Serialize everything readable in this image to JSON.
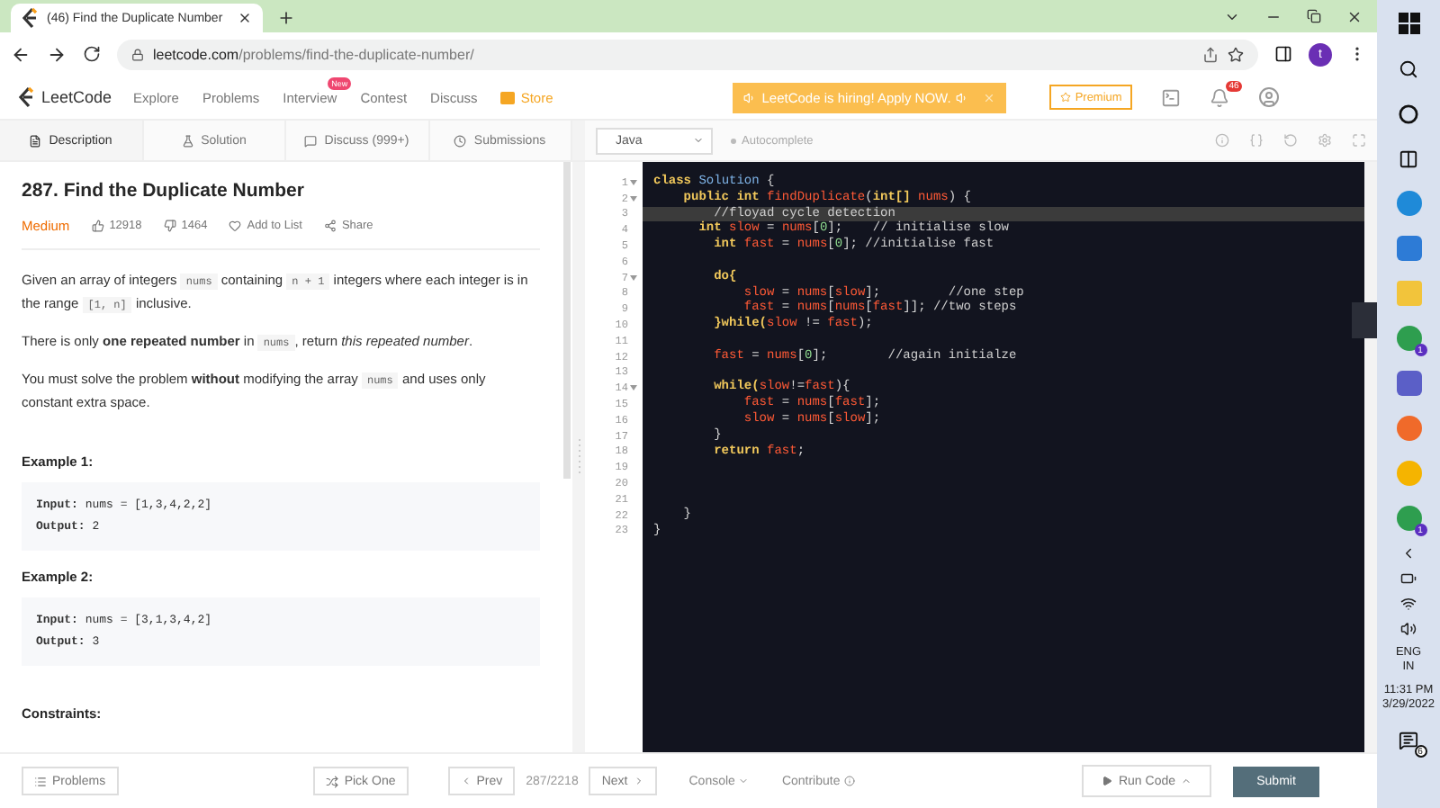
{
  "browser": {
    "tab_title": "(46) Find the Duplicate Number",
    "url_host": "leetcode.com",
    "url_path": "/problems/find-the-duplicate-number/",
    "avatar_letter": "t"
  },
  "nav": {
    "brand": "LeetCode",
    "links": [
      {
        "label": "Explore"
      },
      {
        "label": "Problems"
      },
      {
        "label": "Interview",
        "badge": "New"
      },
      {
        "label": "Contest"
      },
      {
        "label": "Discuss"
      }
    ],
    "store": "Store",
    "banner": "LeetCode is hiring! Apply NOW.",
    "premium": "Premium",
    "notification_count": "46"
  },
  "tabs": [
    {
      "label": "Description",
      "kind": "description",
      "selected": true
    },
    {
      "label": "Solution",
      "kind": "solution",
      "selected": false
    },
    {
      "label": "Discuss (999+)",
      "kind": "discuss",
      "selected": false
    },
    {
      "label": "Submissions",
      "kind": "submissions",
      "selected": false
    }
  ],
  "problem": {
    "title": "287. Find the Duplicate Number",
    "difficulty": "Medium",
    "likes": "12918",
    "dislikes": "1464",
    "add_to_list": "Add to List",
    "share": "Share",
    "paragraphs": [
      [
        {
          "kind": "text",
          "text": "Given an array of integers "
        },
        {
          "kind": "code",
          "text": "nums"
        },
        {
          "kind": "text",
          "text": " containing "
        },
        {
          "kind": "code",
          "text": "n + 1"
        },
        {
          "kind": "text",
          "text": " integers where each integer is in the range "
        },
        {
          "kind": "code",
          "text": "[1, n]"
        },
        {
          "kind": "text",
          "text": " inclusive."
        }
      ],
      [
        {
          "kind": "text",
          "text": "There is only **one repeated number** in "
        },
        {
          "kind": "code",
          "text": "nums"
        },
        {
          "kind": "text",
          "text": ", return *this repeated number*."
        }
      ],
      [
        {
          "kind": "text",
          "text": "You must solve the problem **without** modifying the array "
        },
        {
          "kind": "code",
          "text": "nums"
        },
        {
          "kind": "text",
          "text": " and uses only constant extra space."
        }
      ]
    ],
    "examples": [
      {
        "heading": "Example 1:",
        "input_label": "Input:",
        "input": "nums = [1,3,4,2,2]",
        "output_label": "Output:",
        "output": "2"
      },
      {
        "heading": "Example 2:",
        "input_label": "Input:",
        "input": "nums = [3,1,3,4,2]",
        "output_label": "Output:",
        "output": "3"
      }
    ],
    "constraints_heading": "Constraints:"
  },
  "editor": {
    "language": "Java",
    "autocomplete": "Autocomplete",
    "lines": [
      {
        "number": "1",
        "foldable": true,
        "active": false,
        "tokens": [
          {
            "kind": "kw",
            "text": "class"
          },
          {
            "kind": "type",
            "text": " Solution"
          },
          {
            "kind": "punct",
            "text": " {"
          }
        ]
      },
      {
        "number": "2",
        "foldable": true,
        "active": false,
        "tokens": [
          {
            "kind": "kw",
            "text": "    public int"
          },
          {
            "kind": "ident",
            "text": " findDuplicate"
          },
          {
            "kind": "punct",
            "text": "("
          },
          {
            "kind": "kw",
            "text": "int[]"
          },
          {
            "kind": "ident",
            "text": " nums"
          },
          {
            "kind": "punct",
            "text": ") {"
          }
        ]
      },
      {
        "number": "3",
        "foldable": false,
        "active": true,
        "tokens": [
          {
            "kind": "comment",
            "text": "        //floyad cycle detection"
          }
        ]
      },
      {
        "number": "4",
        "foldable": false,
        "active": false,
        "tokens": [
          {
            "kind": "kw",
            "text": "      int"
          },
          {
            "kind": "ident",
            "text": " slow"
          },
          {
            "kind": "punct",
            "text": " = "
          },
          {
            "kind": "ident",
            "text": "nums"
          },
          {
            "kind": "punct",
            "text": "["
          },
          {
            "kind": "num",
            "text": "0"
          },
          {
            "kind": "punct",
            "text": "];"
          },
          {
            "kind": "comment",
            "text": "    // initialise slow"
          }
        ]
      },
      {
        "number": "5",
        "foldable": false,
        "active": false,
        "tokens": [
          {
            "kind": "kw",
            "text": "        int"
          },
          {
            "kind": "ident",
            "text": " fast"
          },
          {
            "kind": "punct",
            "text": " = "
          },
          {
            "kind": "ident",
            "text": "nums"
          },
          {
            "kind": "punct",
            "text": "["
          },
          {
            "kind": "num",
            "text": "0"
          },
          {
            "kind": "punct",
            "text": "];"
          },
          {
            "kind": "comment",
            "text": " //initialise fast"
          }
        ]
      },
      {
        "number": "6",
        "foldable": false,
        "active": false
      },
      {
        "number": "7",
        "foldable": true,
        "active": false,
        "tokens": [
          {
            "kind": "kw",
            "text": "        do{"
          }
        ]
      },
      {
        "number": "8",
        "foldable": false,
        "active": false,
        "tokens": [
          {
            "kind": "ident",
            "text": "            slow"
          },
          {
            "kind": "punct",
            "text": " = "
          },
          {
            "kind": "ident",
            "text": "nums"
          },
          {
            "kind": "punct",
            "text": "["
          },
          {
            "kind": "ident",
            "text": "slow"
          },
          {
            "kind": "punct",
            "text": "];"
          },
          {
            "kind": "comment",
            "text": "         //one step"
          }
        ]
      },
      {
        "number": "9",
        "foldable": false,
        "active": false,
        "tokens": [
          {
            "kind": "ident",
            "text": "            fast"
          },
          {
            "kind": "punct",
            "text": " = "
          },
          {
            "kind": "ident",
            "text": "nums"
          },
          {
            "kind": "punct",
            "text": "["
          },
          {
            "kind": "ident",
            "text": "nums"
          },
          {
            "kind": "punct",
            "text": "["
          },
          {
            "kind": "ident",
            "text": "fast"
          },
          {
            "kind": "punct",
            "text": "]];"
          },
          {
            "kind": "comment",
            "text": " //two steps"
          }
        ]
      },
      {
        "number": "10",
        "foldable": false,
        "active": false,
        "tokens": [
          {
            "kind": "kw",
            "text": "        }while("
          },
          {
            "kind": "ident",
            "text": "slow"
          },
          {
            "kind": "punct",
            "text": " != "
          },
          {
            "kind": "ident",
            "text": "fast"
          },
          {
            "kind": "punct",
            "text": ");"
          }
        ]
      },
      {
        "number": "11",
        "foldable": false,
        "active": false
      },
      {
        "number": "12",
        "foldable": false,
        "active": false,
        "tokens": [
          {
            "kind": "ident",
            "text": "        fast"
          },
          {
            "kind": "punct",
            "text": " = "
          },
          {
            "kind": "ident",
            "text": "nums"
          },
          {
            "kind": "punct",
            "text": "["
          },
          {
            "kind": "num",
            "text": "0"
          },
          {
            "kind": "punct",
            "text": "];"
          },
          {
            "kind": "comment",
            "text": "        //again initialze"
          }
        ]
      },
      {
        "number": "13",
        "foldable": false,
        "active": false
      },
      {
        "number": "14",
        "foldable": true,
        "active": false,
        "tokens": [
          {
            "kind": "kw",
            "text": "        while("
          },
          {
            "kind": "ident",
            "text": "slow"
          },
          {
            "kind": "punct",
            "text": "!="
          },
          {
            "kind": "ident",
            "text": "fast"
          },
          {
            "kind": "punct",
            "text": "){"
          }
        ]
      },
      {
        "number": "15",
        "foldable": false,
        "active": false,
        "tokens": [
          {
            "kind": "ident",
            "text": "            fast"
          },
          {
            "kind": "punct",
            "text": " = "
          },
          {
            "kind": "ident",
            "text": "nums"
          },
          {
            "kind": "punct",
            "text": "["
          },
          {
            "kind": "ident",
            "text": "fast"
          },
          {
            "kind": "punct",
            "text": "];"
          }
        ]
      },
      {
        "number": "16",
        "foldable": false,
        "active": false,
        "tokens": [
          {
            "kind": "ident",
            "text": "            slow"
          },
          {
            "kind": "punct",
            "text": " = "
          },
          {
            "kind": "ident",
            "text": "nums"
          },
          {
            "kind": "punct",
            "text": "["
          },
          {
            "kind": "ident",
            "text": "slow"
          },
          {
            "kind": "punct",
            "text": "];"
          }
        ]
      },
      {
        "number": "17",
        "foldable": false,
        "active": false,
        "tokens": [
          {
            "kind": "punct",
            "text": "        }"
          }
        ]
      },
      {
        "number": "18",
        "foldable": false,
        "active": false,
        "tokens": [
          {
            "kind": "kw",
            "text": "        return"
          },
          {
            "kind": "ident",
            "text": " fast"
          },
          {
            "kind": "punct",
            "text": ";"
          }
        ]
      },
      {
        "number": "19",
        "foldable": false,
        "active": false
      },
      {
        "number": "20",
        "foldable": false,
        "active": false
      },
      {
        "number": "21",
        "foldable": false,
        "active": false
      },
      {
        "number": "22",
        "foldable": false,
        "active": false,
        "tokens": [
          {
            "kind": "punct",
            "text": "    }"
          }
        ]
      },
      {
        "number": "23",
        "foldable": false,
        "active": false,
        "tokens": [
          {
            "kind": "punct",
            "text": "}"
          }
        ]
      }
    ]
  },
  "footer": {
    "problems": "Problems",
    "pick_one": "Pick One",
    "prev": "Prev",
    "position": "287/2218",
    "next": "Next",
    "console": "Console",
    "contribute": "Contribute",
    "run_code": "Run Code",
    "submit": "Submit"
  },
  "taskbar": {
    "app_badges": [
      "1",
      "1"
    ],
    "language": "ENG",
    "region": "IN",
    "time": "11:31 PM",
    "date": "3/29/2022",
    "notification_count": "6"
  }
}
